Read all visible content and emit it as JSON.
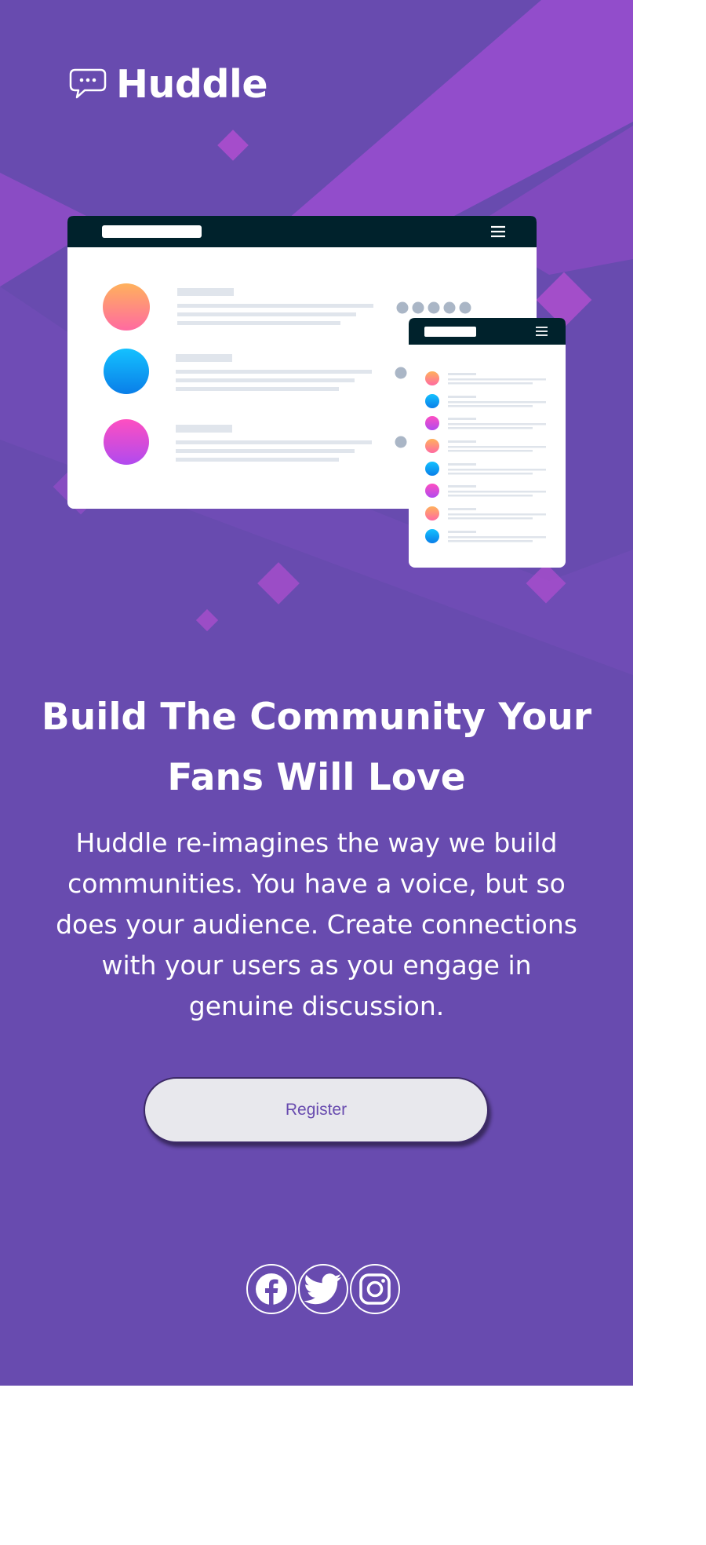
{
  "brand": {
    "name": "Huddle",
    "logo_icon": "chat-bubble-icon"
  },
  "mockup": {
    "desktop_window": {
      "menu_icon": "hamburger-icon"
    },
    "mobile_window": {
      "menu_icon": "hamburger-icon"
    },
    "avatar_colors": [
      "#ff9f7b",
      "#0ba2f3",
      "#e454d2"
    ]
  },
  "hero": {
    "headline": "Build The Community Your Fans Will Love",
    "description": "Huddle re-imagines the way we build communities. You have a voice, but so does your audience. Create connections with your users as you engage in genuine discussion.",
    "cta_label": "Register"
  },
  "social": [
    {
      "name": "Facebook",
      "icon": "facebook-icon"
    },
    {
      "name": "Twitter",
      "icon": "twitter-icon"
    },
    {
      "name": "Instagram",
      "icon": "instagram-icon"
    }
  ],
  "colors": {
    "background": "#684baf",
    "accent": "#9c4cd0",
    "text": "#ffffff",
    "button_bg": "#e8e8ed"
  }
}
